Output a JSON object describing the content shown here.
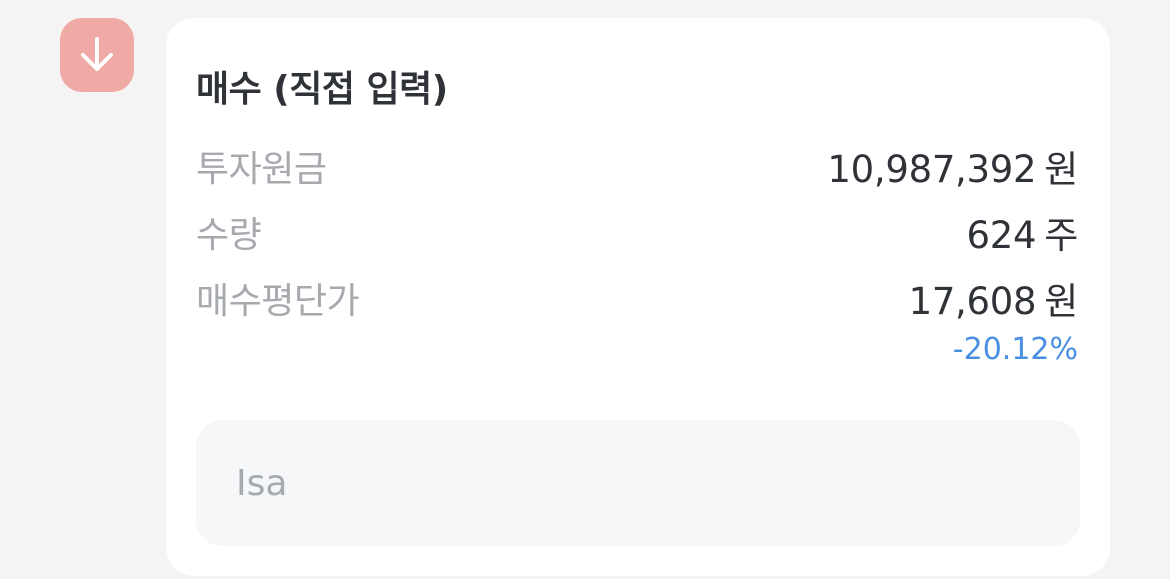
{
  "badge": {
    "icon": "arrow-down-icon",
    "color": "#f0aaa6"
  },
  "card": {
    "title": "매수 (직접 입력)",
    "rows": [
      {
        "label": "투자원금",
        "value": "10,987,392",
        "unit": "원"
      },
      {
        "label": "수량",
        "value": "624",
        "unit": "주"
      },
      {
        "label": "매수평단가",
        "value": "17,608",
        "unit": "원"
      }
    ],
    "change": "-20.12%",
    "change_color": "#4a90e2",
    "memo": "Isa"
  }
}
